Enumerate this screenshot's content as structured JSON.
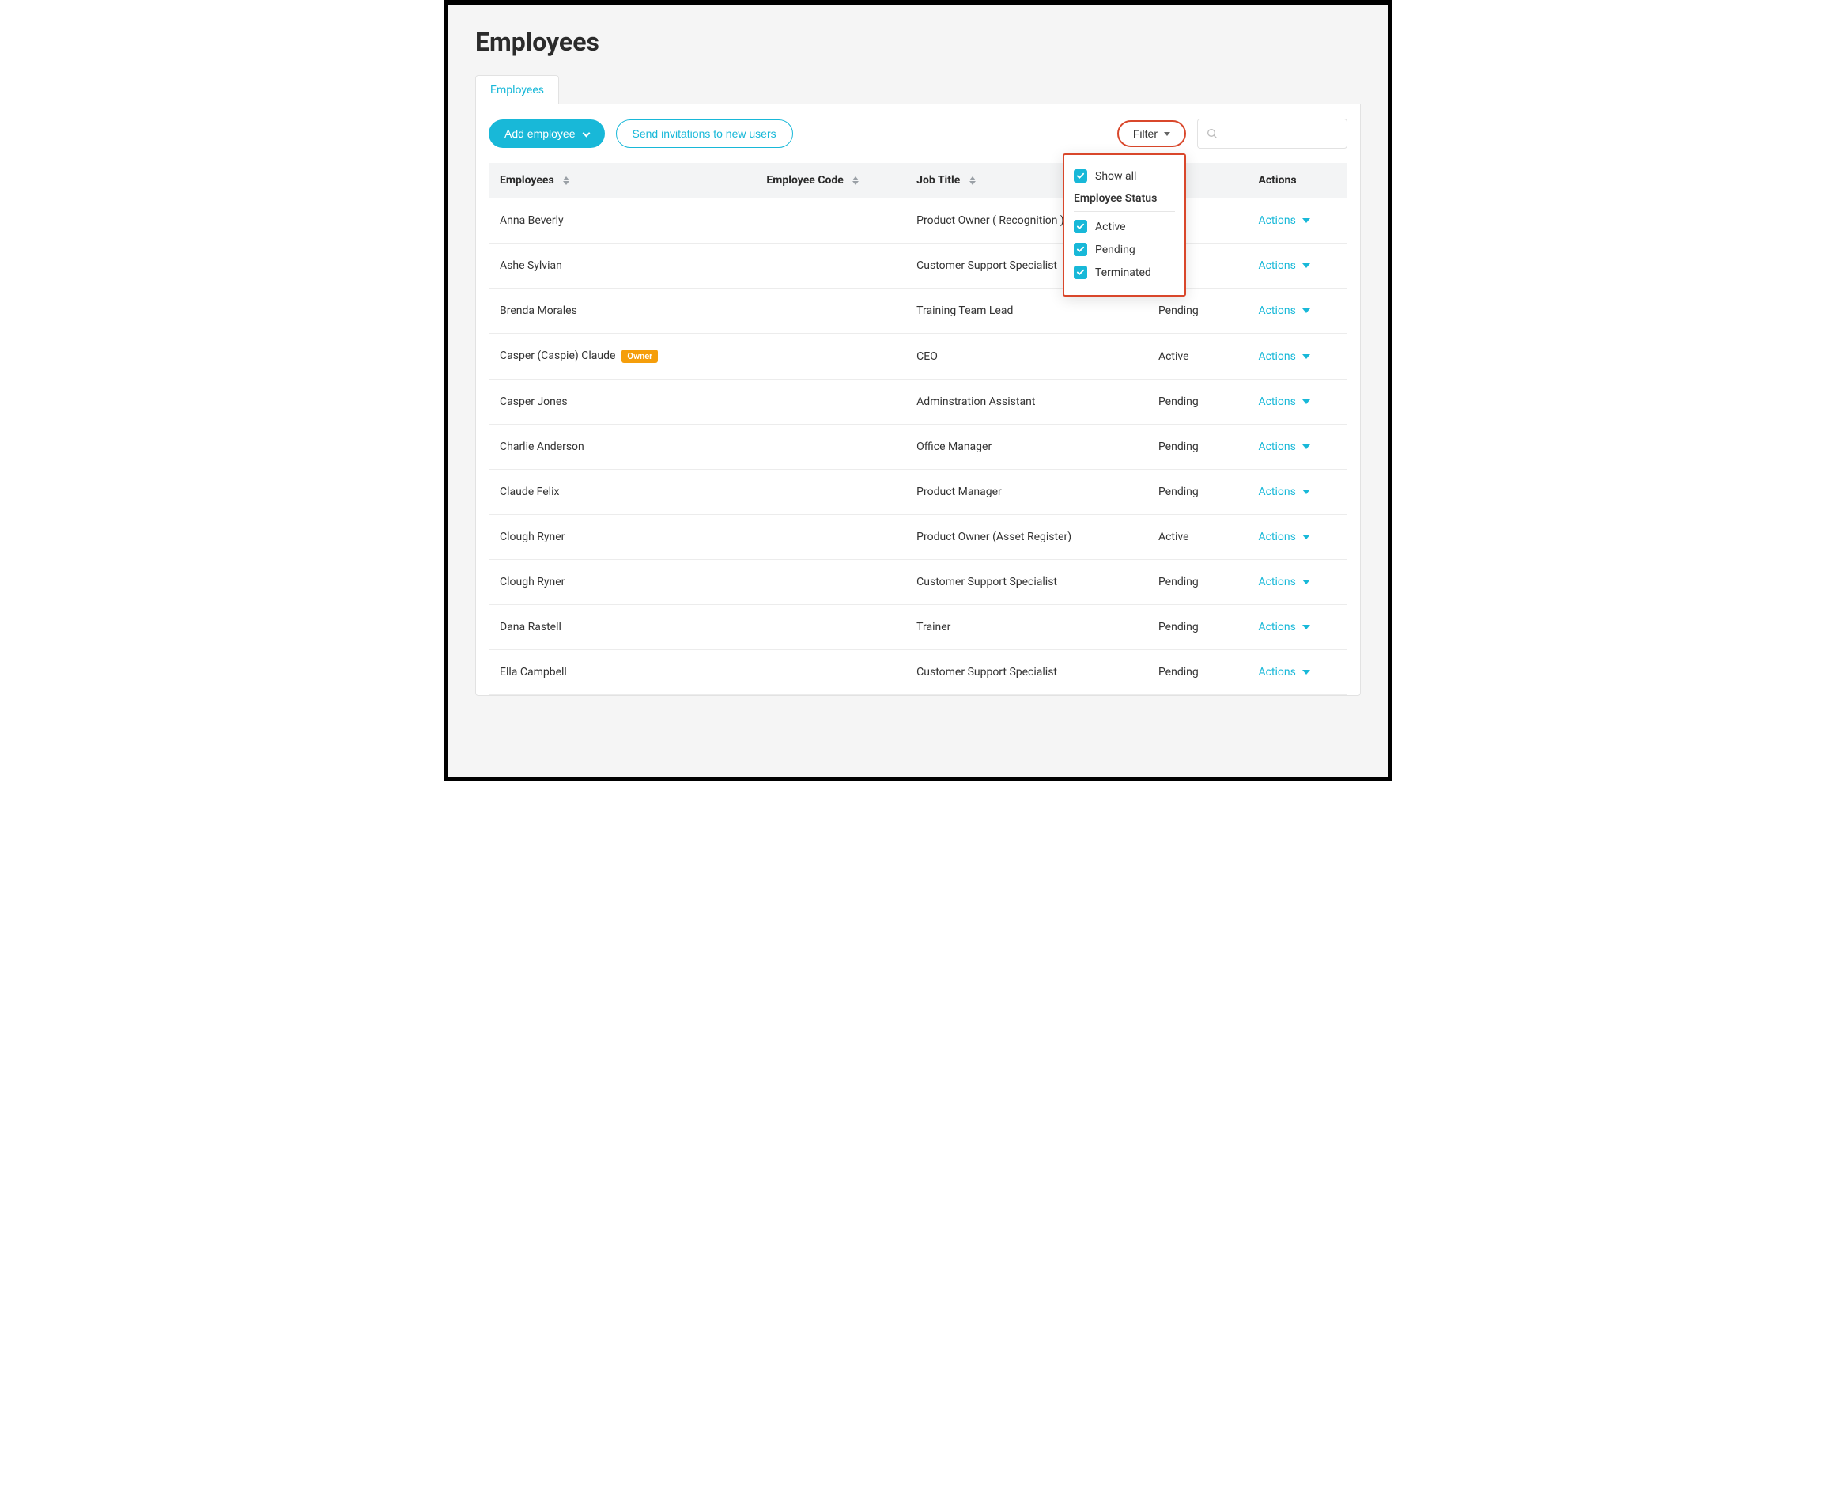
{
  "page": {
    "title": "Employees"
  },
  "tabs": {
    "employees": "Employees"
  },
  "toolbar": {
    "add_employee_label": "Add employee",
    "send_invitations_label": "Send invitations to new users",
    "filter_label": "Filter",
    "search_placeholder": ""
  },
  "filter_dropdown": {
    "show_all_label": "Show all",
    "section_title": "Employee Status",
    "options": [
      {
        "label": "Active",
        "checked": true
      },
      {
        "label": "Pending",
        "checked": true
      },
      {
        "label": "Terminated",
        "checked": true
      }
    ],
    "show_all_checked": true
  },
  "columns": {
    "employees": "Employees",
    "employee_code": "Employee Code",
    "job_title": "Job Title",
    "status": "",
    "actions": "Actions"
  },
  "actions_label": "Actions",
  "owner_badge": "Owner",
  "rows": [
    {
      "name": "Anna Beverly",
      "code": "",
      "title": "Product Owner ( Recognition )",
      "status": "",
      "owner": false
    },
    {
      "name": "Ashe Sylvian",
      "code": "",
      "title": "Customer Support Specialist",
      "status": "",
      "owner": false
    },
    {
      "name": "Brenda Morales",
      "code": "",
      "title": "Training Team Lead",
      "status": "Pending",
      "owner": false
    },
    {
      "name": "Casper (Caspie) Claude",
      "code": "",
      "title": "CEO",
      "status": "Active",
      "owner": true
    },
    {
      "name": "Casper Jones",
      "code": "",
      "title": "Adminstration Assistant",
      "status": "Pending",
      "owner": false
    },
    {
      "name": "Charlie Anderson",
      "code": "",
      "title": "Office Manager",
      "status": "Pending",
      "owner": false
    },
    {
      "name": "Claude Felix",
      "code": "",
      "title": "Product Manager",
      "status": "Pending",
      "owner": false
    },
    {
      "name": "Clough Ryner",
      "code": "",
      "title": "Product Owner (Asset Register)",
      "status": "Active",
      "owner": false
    },
    {
      "name": "Clough Ryner",
      "code": "",
      "title": "Customer Support Specialist",
      "status": "Pending",
      "owner": false
    },
    {
      "name": "Dana Rastell",
      "code": "",
      "title": "Trainer",
      "status": "Pending",
      "owner": false
    },
    {
      "name": "Ella Campbell",
      "code": "",
      "title": "Customer Support Specialist",
      "status": "Pending",
      "owner": false
    }
  ]
}
